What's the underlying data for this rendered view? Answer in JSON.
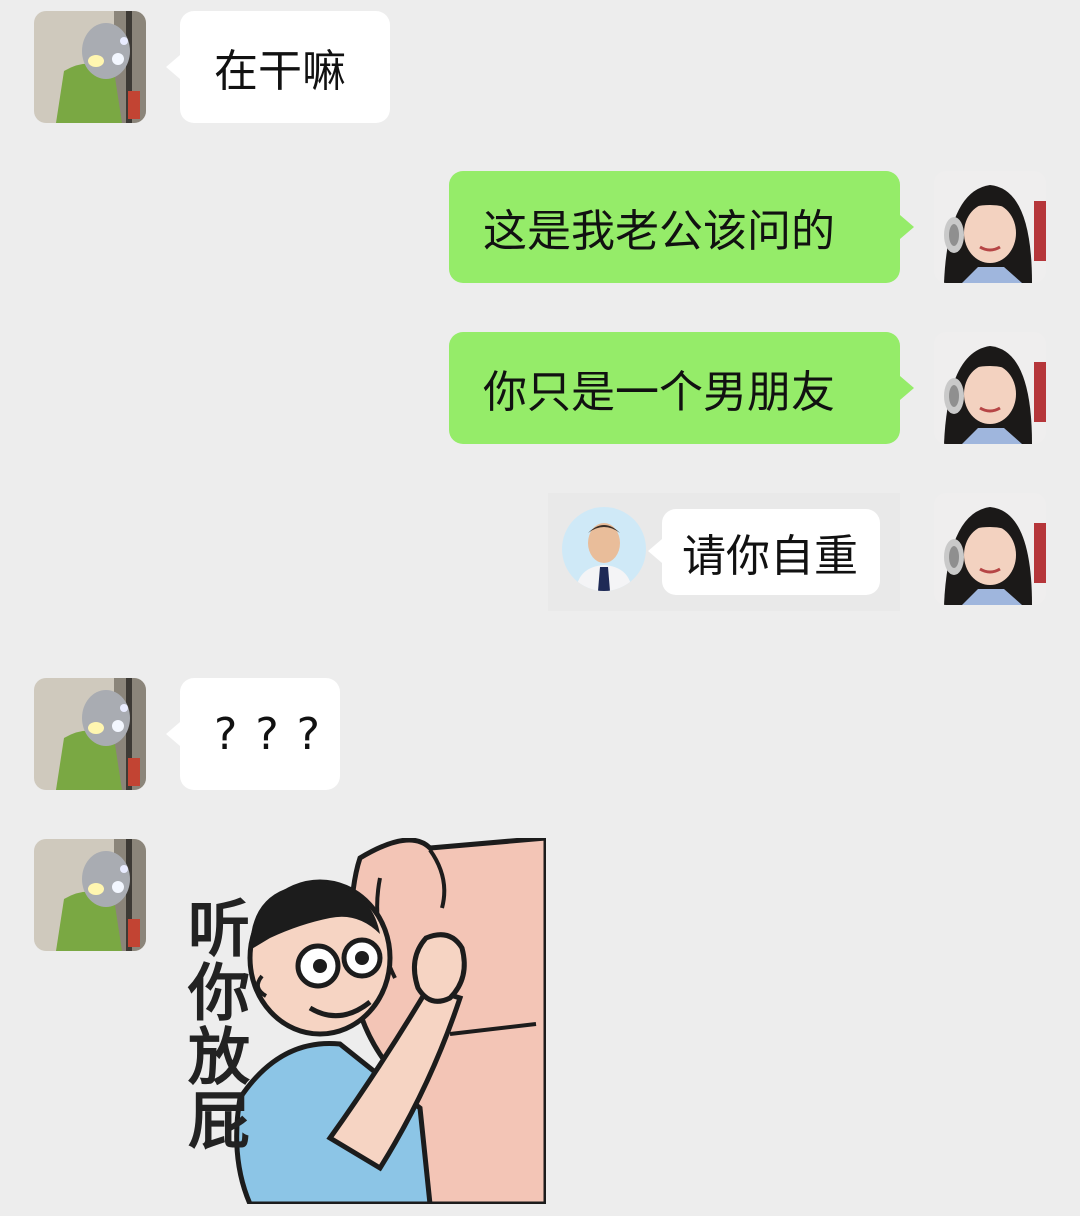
{
  "messages": [
    {
      "from": "contact",
      "text": "在干嘛"
    },
    {
      "from": "me",
      "text": "这是我老公该问的"
    },
    {
      "from": "me",
      "text": "你只是一个男朋友"
    },
    {
      "from": "me",
      "quote_text": "请你自重"
    },
    {
      "from": "contact",
      "text": "? ? ?"
    },
    {
      "from": "contact",
      "sticker_caption": "听你放屁"
    }
  ],
  "colors": {
    "background": "#ededed",
    "incoming_bubble": "#ffffff",
    "outgoing_bubble": "#95ec69"
  },
  "icons": {
    "contact_avatar": "ultraman-photo-avatar",
    "my_avatar": "girl-headphones-photo-avatar",
    "quote_avatar": "man-in-suit-photo"
  }
}
